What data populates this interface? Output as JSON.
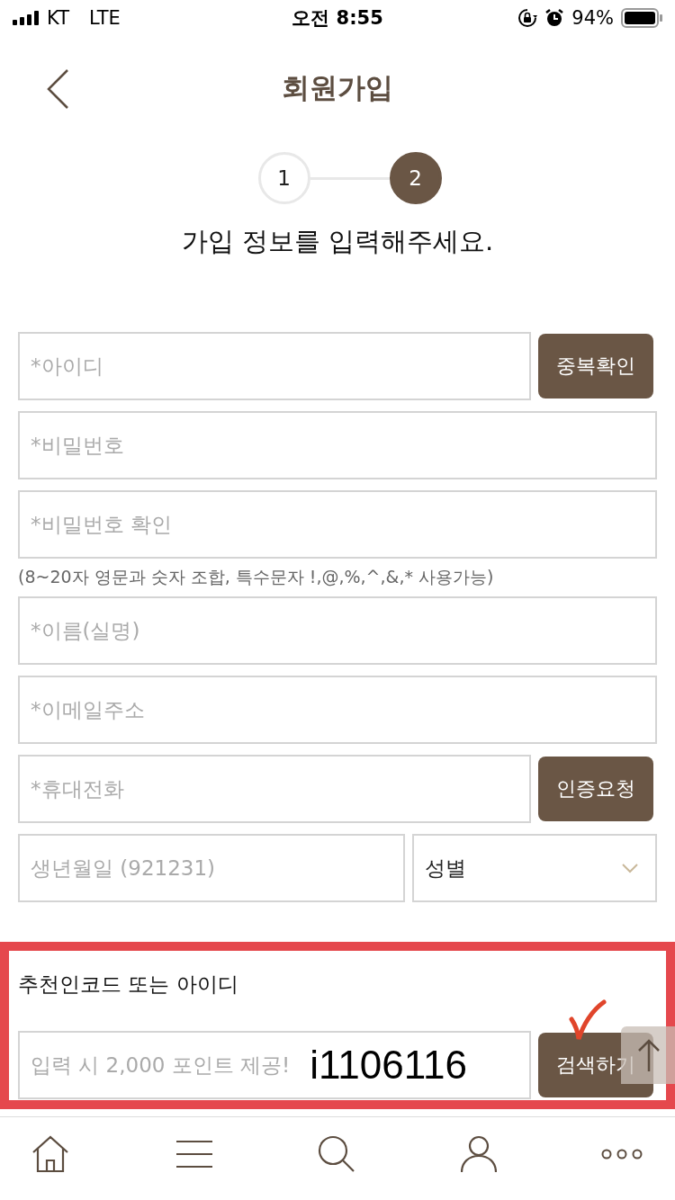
{
  "status_bar": {
    "carrier": "KT",
    "network": "LTE",
    "time": "오전 8:55",
    "battery": "94%"
  },
  "header": {
    "title": "회원가입"
  },
  "steps": [
    {
      "label": "1",
      "selected": false
    },
    {
      "label": "2",
      "selected": true
    }
  ],
  "subtitle": "가입 정보를 입력해주세요.",
  "form": [
    {
      "kind": "field",
      "placeholder": "*아이디",
      "button": "중복확인"
    },
    {
      "kind": "field",
      "placeholder": "*비밀번호"
    },
    {
      "kind": "field",
      "placeholder": "*비밀번호 확인"
    },
    {
      "kind": "hint",
      "text": "(8~20자 영문과 숫자 조합, 특수문자 !,@,%,^,&,* 사용가능)"
    },
    {
      "kind": "field",
      "placeholder": "*이름(실명)"
    },
    {
      "kind": "field",
      "placeholder": "*이메일주소"
    },
    {
      "kind": "field",
      "placeholder": "*휴대전화",
      "button": "인증요청"
    },
    {
      "kind": "pair",
      "placeholder": "생년월일 (921231)",
      "select": "성별"
    }
  ],
  "referral": {
    "label": "추천인코드 또는 아이디",
    "placeholder": "입력 시 2,000 포인트 제공!",
    "annotation": "i1106116",
    "button": "검색하기"
  }
}
